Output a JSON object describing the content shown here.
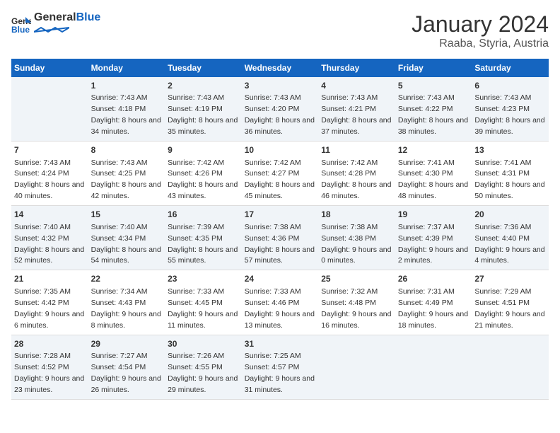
{
  "header": {
    "logo_general": "General",
    "logo_blue": "Blue",
    "title": "January 2024",
    "subtitle": "Raaba, Styria, Austria"
  },
  "days_of_week": [
    "Sunday",
    "Monday",
    "Tuesday",
    "Wednesday",
    "Thursday",
    "Friday",
    "Saturday"
  ],
  "weeks": [
    [
      {
        "day": "",
        "sunrise": "",
        "sunset": "",
        "daylight": ""
      },
      {
        "day": "1",
        "sunrise": "Sunrise: 7:43 AM",
        "sunset": "Sunset: 4:18 PM",
        "daylight": "Daylight: 8 hours and 34 minutes."
      },
      {
        "day": "2",
        "sunrise": "Sunrise: 7:43 AM",
        "sunset": "Sunset: 4:19 PM",
        "daylight": "Daylight: 8 hours and 35 minutes."
      },
      {
        "day": "3",
        "sunrise": "Sunrise: 7:43 AM",
        "sunset": "Sunset: 4:20 PM",
        "daylight": "Daylight: 8 hours and 36 minutes."
      },
      {
        "day": "4",
        "sunrise": "Sunrise: 7:43 AM",
        "sunset": "Sunset: 4:21 PM",
        "daylight": "Daylight: 8 hours and 37 minutes."
      },
      {
        "day": "5",
        "sunrise": "Sunrise: 7:43 AM",
        "sunset": "Sunset: 4:22 PM",
        "daylight": "Daylight: 8 hours and 38 minutes."
      },
      {
        "day": "6",
        "sunrise": "Sunrise: 7:43 AM",
        "sunset": "Sunset: 4:23 PM",
        "daylight": "Daylight: 8 hours and 39 minutes."
      }
    ],
    [
      {
        "day": "7",
        "sunrise": "Sunrise: 7:43 AM",
        "sunset": "Sunset: 4:24 PM",
        "daylight": "Daylight: 8 hours and 40 minutes."
      },
      {
        "day": "8",
        "sunrise": "Sunrise: 7:43 AM",
        "sunset": "Sunset: 4:25 PM",
        "daylight": "Daylight: 8 hours and 42 minutes."
      },
      {
        "day": "9",
        "sunrise": "Sunrise: 7:42 AM",
        "sunset": "Sunset: 4:26 PM",
        "daylight": "Daylight: 8 hours and 43 minutes."
      },
      {
        "day": "10",
        "sunrise": "Sunrise: 7:42 AM",
        "sunset": "Sunset: 4:27 PM",
        "daylight": "Daylight: 8 hours and 45 minutes."
      },
      {
        "day": "11",
        "sunrise": "Sunrise: 7:42 AM",
        "sunset": "Sunset: 4:28 PM",
        "daylight": "Daylight: 8 hours and 46 minutes."
      },
      {
        "day": "12",
        "sunrise": "Sunrise: 7:41 AM",
        "sunset": "Sunset: 4:30 PM",
        "daylight": "Daylight: 8 hours and 48 minutes."
      },
      {
        "day": "13",
        "sunrise": "Sunrise: 7:41 AM",
        "sunset": "Sunset: 4:31 PM",
        "daylight": "Daylight: 8 hours and 50 minutes."
      }
    ],
    [
      {
        "day": "14",
        "sunrise": "Sunrise: 7:40 AM",
        "sunset": "Sunset: 4:32 PM",
        "daylight": "Daylight: 8 hours and 52 minutes."
      },
      {
        "day": "15",
        "sunrise": "Sunrise: 7:40 AM",
        "sunset": "Sunset: 4:34 PM",
        "daylight": "Daylight: 8 hours and 54 minutes."
      },
      {
        "day": "16",
        "sunrise": "Sunrise: 7:39 AM",
        "sunset": "Sunset: 4:35 PM",
        "daylight": "Daylight: 8 hours and 55 minutes."
      },
      {
        "day": "17",
        "sunrise": "Sunrise: 7:38 AM",
        "sunset": "Sunset: 4:36 PM",
        "daylight": "Daylight: 8 hours and 57 minutes."
      },
      {
        "day": "18",
        "sunrise": "Sunrise: 7:38 AM",
        "sunset": "Sunset: 4:38 PM",
        "daylight": "Daylight: 9 hours and 0 minutes."
      },
      {
        "day": "19",
        "sunrise": "Sunrise: 7:37 AM",
        "sunset": "Sunset: 4:39 PM",
        "daylight": "Daylight: 9 hours and 2 minutes."
      },
      {
        "day": "20",
        "sunrise": "Sunrise: 7:36 AM",
        "sunset": "Sunset: 4:40 PM",
        "daylight": "Daylight: 9 hours and 4 minutes."
      }
    ],
    [
      {
        "day": "21",
        "sunrise": "Sunrise: 7:35 AM",
        "sunset": "Sunset: 4:42 PM",
        "daylight": "Daylight: 9 hours and 6 minutes."
      },
      {
        "day": "22",
        "sunrise": "Sunrise: 7:34 AM",
        "sunset": "Sunset: 4:43 PM",
        "daylight": "Daylight: 9 hours and 8 minutes."
      },
      {
        "day": "23",
        "sunrise": "Sunrise: 7:33 AM",
        "sunset": "Sunset: 4:45 PM",
        "daylight": "Daylight: 9 hours and 11 minutes."
      },
      {
        "day": "24",
        "sunrise": "Sunrise: 7:33 AM",
        "sunset": "Sunset: 4:46 PM",
        "daylight": "Daylight: 9 hours and 13 minutes."
      },
      {
        "day": "25",
        "sunrise": "Sunrise: 7:32 AM",
        "sunset": "Sunset: 4:48 PM",
        "daylight": "Daylight: 9 hours and 16 minutes."
      },
      {
        "day": "26",
        "sunrise": "Sunrise: 7:31 AM",
        "sunset": "Sunset: 4:49 PM",
        "daylight": "Daylight: 9 hours and 18 minutes."
      },
      {
        "day": "27",
        "sunrise": "Sunrise: 7:29 AM",
        "sunset": "Sunset: 4:51 PM",
        "daylight": "Daylight: 9 hours and 21 minutes."
      }
    ],
    [
      {
        "day": "28",
        "sunrise": "Sunrise: 7:28 AM",
        "sunset": "Sunset: 4:52 PM",
        "daylight": "Daylight: 9 hours and 23 minutes."
      },
      {
        "day": "29",
        "sunrise": "Sunrise: 7:27 AM",
        "sunset": "Sunset: 4:54 PM",
        "daylight": "Daylight: 9 hours and 26 minutes."
      },
      {
        "day": "30",
        "sunrise": "Sunrise: 7:26 AM",
        "sunset": "Sunset: 4:55 PM",
        "daylight": "Daylight: 9 hours and 29 minutes."
      },
      {
        "day": "31",
        "sunrise": "Sunrise: 7:25 AM",
        "sunset": "Sunset: 4:57 PM",
        "daylight": "Daylight: 9 hours and 31 minutes."
      },
      {
        "day": "",
        "sunrise": "",
        "sunset": "",
        "daylight": ""
      },
      {
        "day": "",
        "sunrise": "",
        "sunset": "",
        "daylight": ""
      },
      {
        "day": "",
        "sunrise": "",
        "sunset": "",
        "daylight": ""
      }
    ]
  ]
}
